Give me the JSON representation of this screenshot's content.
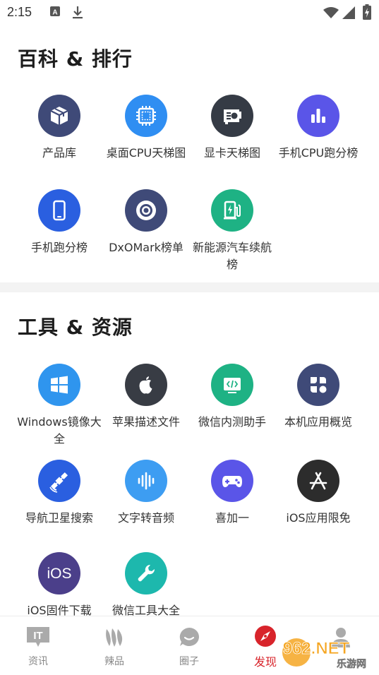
{
  "status_bar": {
    "time": "2:15",
    "left_icons": [
      "text-a-icon",
      "download-icon"
    ],
    "right_icons": [
      "wifi-icon",
      "signal-icon",
      "battery-charging-icon"
    ]
  },
  "sections": [
    {
      "title": "百科 & 排行",
      "items": [
        {
          "label": "产品库",
          "icon": "cube-icon",
          "color": "#3f4a78"
        },
        {
          "label": "桌面CPU天梯图",
          "icon": "cpu-chip-icon",
          "color": "#2f8ef2"
        },
        {
          "label": "显卡天梯图",
          "icon": "graphics-card-icon",
          "color": "#353b45"
        },
        {
          "label": "手机CPU跑分榜",
          "icon": "bar-chart-icon",
          "color": "#5a55e8"
        },
        {
          "label": "手机跑分榜",
          "icon": "smartphone-icon",
          "color": "#2a5fe0"
        },
        {
          "label": "DxOMark榜单",
          "icon": "camera-lens-icon",
          "color": "#3f4a78"
        },
        {
          "label": "新能源汽车续航榜",
          "icon": "ev-charger-icon",
          "color": "#1eb284"
        }
      ]
    },
    {
      "title": "工具 & 资源",
      "items": [
        {
          "label": "Windows镜像大全",
          "icon": "windows-logo-icon",
          "color": "#2f95ee"
        },
        {
          "label": "苹果描述文件",
          "icon": "apple-logo-icon",
          "color": "#383c44"
        },
        {
          "label": "微信内测助手",
          "icon": "code-window-icon",
          "color": "#1eb284"
        },
        {
          "label": "本机应用概览",
          "icon": "app-grid-icon",
          "color": "#3f4a78"
        },
        {
          "label": "导航卫星搜索",
          "icon": "satellite-icon",
          "color": "#2a5fe0"
        },
        {
          "label": "文字转音频",
          "icon": "audio-wave-icon",
          "color": "#3d9df2"
        },
        {
          "label": "喜加一",
          "icon": "gamepad-icon",
          "color": "#5a55e8"
        },
        {
          "label": "iOS应用限免",
          "icon": "app-store-icon",
          "color": "#2c2c2c"
        },
        {
          "label": "iOS固件下载",
          "icon": "ios-badge-icon",
          "color": "#4b3f8a"
        },
        {
          "label": "微信工具大全",
          "icon": "wrench-icon",
          "color": "#1db8ad"
        }
      ]
    }
  ],
  "tabbar": {
    "tabs": [
      {
        "label": "资讯",
        "icon": "it-news-icon",
        "active": false
      },
      {
        "label": "辣品",
        "icon": "chili-icon",
        "active": false
      },
      {
        "label": "圈子",
        "icon": "chat-bubble-icon",
        "active": false
      },
      {
        "label": "发现",
        "icon": "compass-icon",
        "active": true
      },
      {
        "label": "",
        "icon": "profile-icon",
        "active": false
      }
    ],
    "accent": "#d8242b"
  },
  "watermark": {
    "text": "962.NET",
    "subtext": "乐游网"
  }
}
